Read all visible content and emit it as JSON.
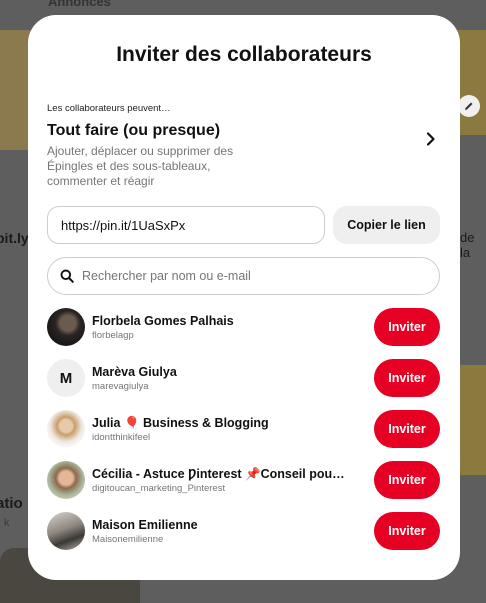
{
  "background": {
    "top_label": "Annonces",
    "left_text_1": "bit.ly",
    "right_text_1": "de la",
    "left_text_2": "atio",
    "left_text_3": "| k"
  },
  "modal": {
    "title": "Inviter des collaborateurs",
    "permission": {
      "caption": "Les collaborateurs peuvent…",
      "title": "Tout faire (ou presque)",
      "description": "Ajouter, déplacer ou supprimer des Épingles et des sous-tableaux, commenter et réagir"
    },
    "share_link": {
      "value": "https://pin.it/1UaSxPx",
      "copy_label": "Copier le lien"
    },
    "search": {
      "placeholder": "Rechercher par nom ou e-mail"
    },
    "invite_label": "Inviter",
    "users": [
      {
        "name": "Florbela Gomes Palhais",
        "handle": "florbelagp",
        "avatar": "photo-dark-hair"
      },
      {
        "name": "Marèva Giulya",
        "handle": "marevagiulya",
        "avatar_letter": "M"
      },
      {
        "name": "Julia 🎈 Business & Blogging",
        "handle": "idontthinkifeel",
        "avatar": "photo-blonde"
      },
      {
        "name": "Cécilia - Astuce Ƿinterest 📌Conseil pou…",
        "handle": "digitoucan_marketing_Pinterest",
        "avatar": "photo-smiling"
      },
      {
        "name": "Maison Emilienne",
        "handle": "Maisonemilienne",
        "avatar": "photo-interior"
      }
    ]
  },
  "colors": {
    "accent": "#e60023",
    "overlay": "#5e5e5e"
  }
}
